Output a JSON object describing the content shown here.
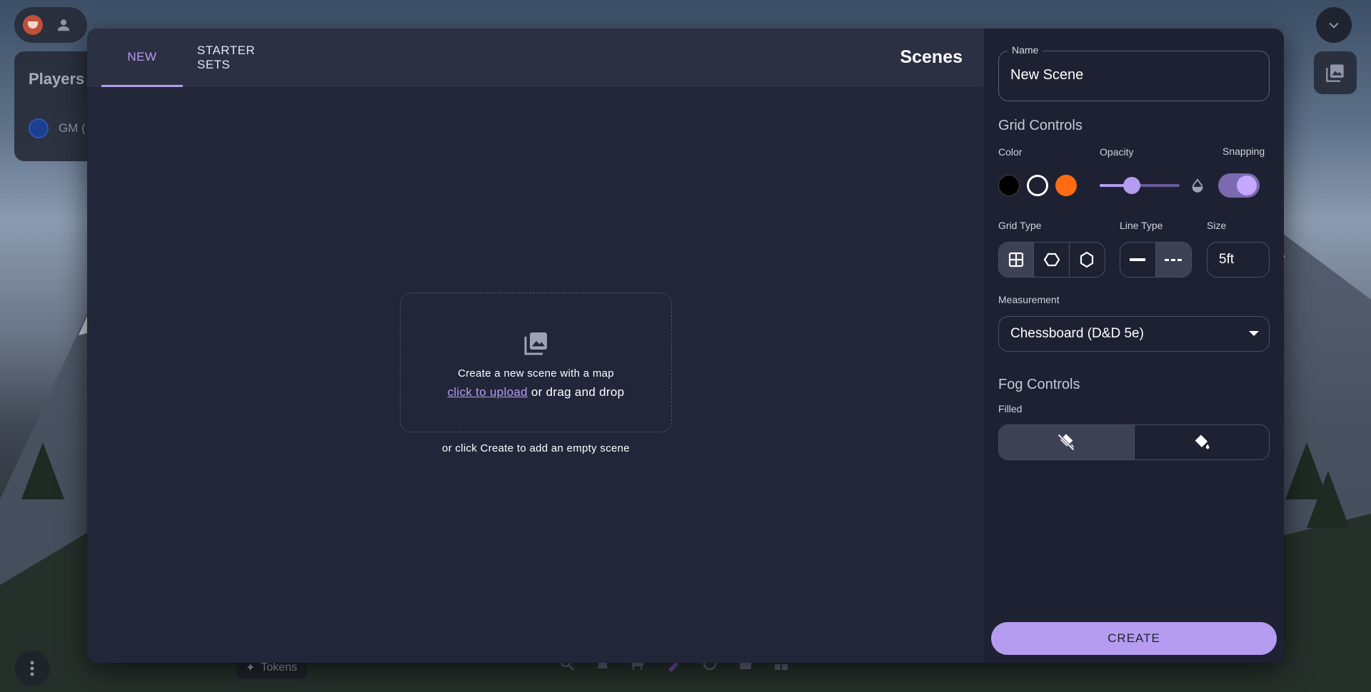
{
  "background": {
    "players_title": "Players",
    "gm_label": "GM (",
    "tokens_label": "Tokens"
  },
  "modal": {
    "tabs": [
      {
        "label": "NEW",
        "active": true
      },
      {
        "label": "STARTER SETS",
        "active": false
      }
    ],
    "title": "Scenes",
    "dropzone": {
      "line1": "Create a new scene with a map",
      "upload_link": "click to upload",
      "drag_text": " or drag and drop",
      "hint": "or click Create to add an empty scene"
    }
  },
  "side": {
    "name_label": "Name",
    "name_value": "New Scene",
    "grid_controls_title": "Grid Controls",
    "color_label": "Color",
    "opacity_label": "Opacity",
    "snapping_label": "Snapping",
    "colors": [
      "#000000",
      "#ffffff",
      "#ff6a13"
    ],
    "selected_color": "#ffffff",
    "opacity_value": 0.4,
    "snapping_on": true,
    "grid_type_label": "Grid Type",
    "grid_types": [
      "square-grid-icon",
      "hex-vertical-icon",
      "hex-horizontal-icon"
    ],
    "line_type_label": "Line Type",
    "line_types": [
      "solid-line-icon",
      "dashed-line-icon"
    ],
    "size_label": "Size",
    "size_value": "5ft",
    "measurement_label": "Measurement",
    "measurement_value": "Chessboard (D&D 5e)",
    "fog_controls_title": "Fog Controls",
    "filled_label": "Filled",
    "fog_options": [
      "fill-off-icon",
      "fill-on-icon"
    ],
    "create_label": "CREATE"
  },
  "colors": {
    "accent": "#b59cf0",
    "panel": "#222639",
    "sidebar": "#1e2132"
  }
}
